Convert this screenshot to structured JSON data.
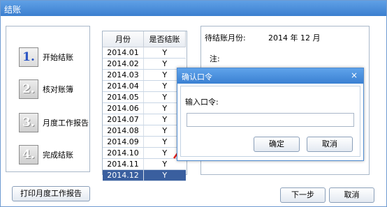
{
  "window": {
    "title": "结账"
  },
  "steps": [
    {
      "num": "1.",
      "label": "开始结账",
      "icon": "step-1-icon"
    },
    {
      "num": "2.",
      "label": "核对账簿",
      "icon": "step-2-icon"
    },
    {
      "num": "3.",
      "label": "月度工作报告",
      "icon": "step-3-icon"
    },
    {
      "num": "4.",
      "label": "完成结账",
      "icon": "step-4-icon"
    }
  ],
  "table": {
    "headers": [
      "月份",
      "是否结账"
    ],
    "rows": [
      [
        "2014.01",
        "Y"
      ],
      [
        "2014.02",
        "Y"
      ],
      [
        "2014.03",
        "Y"
      ],
      [
        "2014.04",
        "Y"
      ],
      [
        "2014.05",
        "Y"
      ],
      [
        "2014.06",
        "Y"
      ],
      [
        "2014.07",
        "Y"
      ],
      [
        "2014.08",
        "Y"
      ],
      [
        "2014.09",
        "Y"
      ],
      [
        "2014.10",
        "Y"
      ],
      [
        "2014.11",
        "Y"
      ],
      [
        "2014.12",
        "Y"
      ]
    ],
    "selected_row": 11
  },
  "info": {
    "pending_label": "待结账月份:",
    "pending_value": "2014 年 12 月",
    "note_label": "注:"
  },
  "buttons": {
    "print": "打印月度工作报告",
    "next": "下一步",
    "cancel": "取消"
  },
  "dialog": {
    "title": "确认口令",
    "close": "×",
    "prompt": "输入口令:",
    "password_value": "",
    "ok": "确定",
    "cancel": "取消"
  },
  "colors": {
    "titlebar": "#3b7fcf",
    "selected_row": "#3a5f9f",
    "arrow": "#e8201a"
  }
}
